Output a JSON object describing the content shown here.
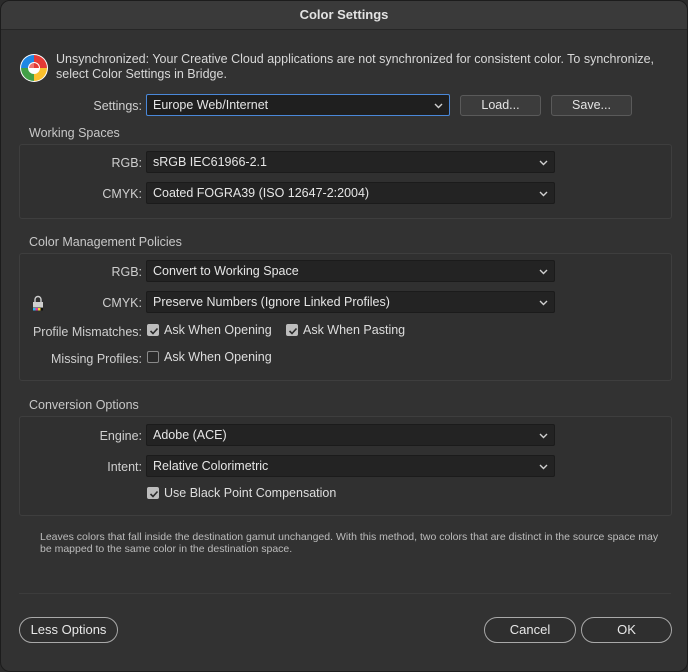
{
  "window": {
    "title": "Color Settings"
  },
  "sync": {
    "message": "Unsynchronized: Your Creative Cloud applications are not synchronized for consistent color. To synchronize, select Color Settings in Bridge."
  },
  "settings": {
    "label": "Settings:",
    "value": "Europe Web/Internet",
    "load_label": "Load...",
    "save_label": "Save..."
  },
  "working_spaces": {
    "title": "Working Spaces",
    "rgb_label": "RGB:",
    "rgb_value": "sRGB IEC61966-2.1",
    "cmyk_label": "CMYK:",
    "cmyk_value": "Coated FOGRA39 (ISO 12647-2:2004)"
  },
  "policies": {
    "title": "Color Management Policies",
    "rgb_label": "RGB:",
    "rgb_value": "Convert to Working Space",
    "cmyk_label": "CMYK:",
    "cmyk_value": "Preserve Numbers (Ignore Linked Profiles)",
    "mismatch_label": "Profile Mismatches:",
    "mismatch_opening": {
      "label": "Ask When Opening",
      "checked": true
    },
    "mismatch_pasting": {
      "label": "Ask When Pasting",
      "checked": true
    },
    "missing_label": "Missing Profiles:",
    "missing_opening": {
      "label": "Ask When Opening",
      "checked": false
    }
  },
  "conversion": {
    "title": "Conversion Options",
    "engine_label": "Engine:",
    "engine_value": "Adobe (ACE)",
    "intent_label": "Intent:",
    "intent_value": "Relative Colorimetric",
    "bpc": {
      "label": "Use Black Point Compensation",
      "checked": true
    }
  },
  "description": "Leaves colors that fall inside the destination gamut unchanged. With this method, two colors that are distinct in the source space may be mapped to the same color in the destination space.",
  "footer": {
    "less_options_label": "Less Options",
    "cancel_label": "Cancel",
    "ok_label": "OK"
  },
  "colors": {
    "focus": "#4a88d9",
    "background": "#323232"
  }
}
